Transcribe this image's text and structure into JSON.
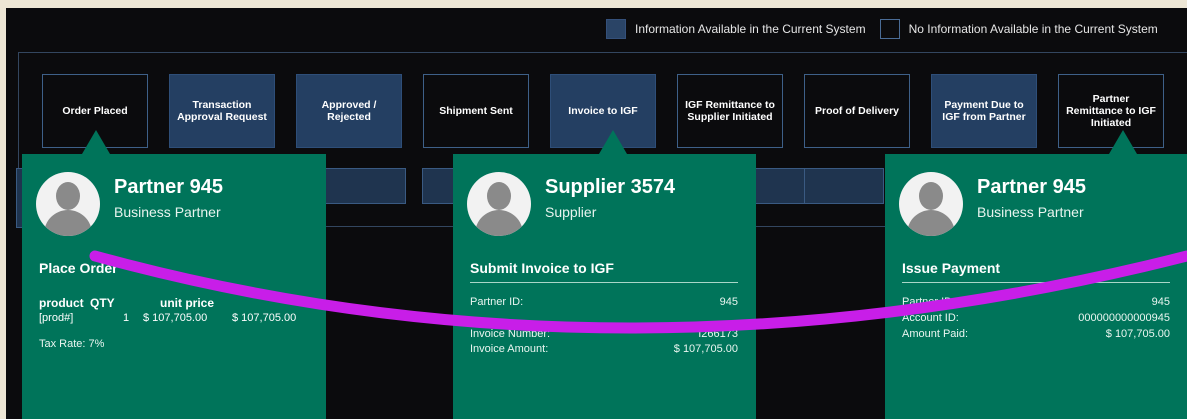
{
  "legend": {
    "available": "Information Available in the Current System",
    "not_available": "No Information Available in the Current System"
  },
  "colors": {
    "card": "#00745a",
    "filled_step": "#243f62",
    "arc": "#c81ee8"
  },
  "steps": [
    {
      "label": "Order Placed",
      "available": false
    },
    {
      "label": "Transaction Approval Request",
      "available": true
    },
    {
      "label": "Approved / Rejected",
      "available": true
    },
    {
      "label": "Shipment Sent",
      "available": false
    },
    {
      "label": "Invoice to IGF",
      "available": true
    },
    {
      "label": "IGF Remittance to Supplier Initiated",
      "available": false
    },
    {
      "label": "Proof of Delivery",
      "available": false
    },
    {
      "label": "Payment Due to IGF from Partner",
      "available": true
    },
    {
      "label": "Partner Remittance to IGF Initiated",
      "available": false
    }
  ],
  "cards": {
    "left": {
      "name": "Partner 945",
      "role": "Business Partner",
      "action": "Place Order",
      "table_headers": [
        "product",
        "QTY",
        "unit price"
      ],
      "row": [
        "[prod#]",
        "1",
        "$ 107,705.00",
        "$ 107,705.00"
      ],
      "tax": "Tax Rate: 7%"
    },
    "middle": {
      "name": "Supplier 3574",
      "role": "Supplier",
      "action": "Submit Invoice to IGF",
      "fields": [
        {
          "label": "Partner ID:",
          "value": "945"
        },
        {
          "label": "Invoice Number:",
          "value": "I266173"
        },
        {
          "label": "Invoice Amount:",
          "value": "$ 107,705.00"
        }
      ]
    },
    "right": {
      "name": "Partner 945",
      "role": "Business Partner",
      "action": "Issue Payment",
      "fields": [
        {
          "label": "Partner ID:",
          "value": "945"
        },
        {
          "label": "Account ID:",
          "value": "000000000000945"
        },
        {
          "label": "Amount Paid:",
          "value": "$ 107,705.00"
        }
      ]
    }
  }
}
